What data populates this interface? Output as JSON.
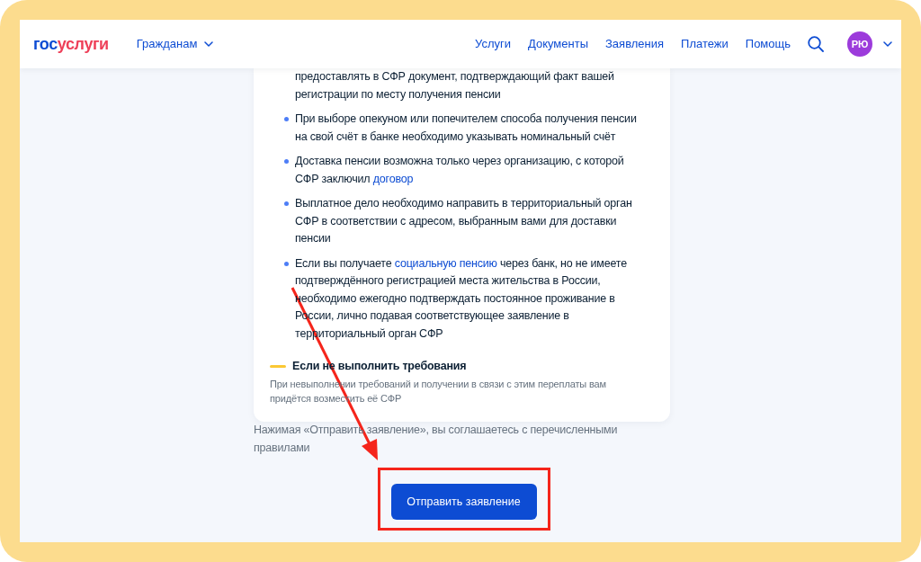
{
  "header": {
    "logo": [
      {
        "text": "гос",
        "color": "#0d4cd3"
      },
      {
        "text": "услуги",
        "color": "#ee3f58"
      }
    ],
    "audience_menu": "Гражданам",
    "nav": [
      "Услуги",
      "Документы",
      "Заявления",
      "Платежи",
      "Помощь"
    ],
    "user_initials": "РЮ"
  },
  "requirements": [
    {
      "kind": "continued",
      "parts": [
        {
          "kind": "text",
          "text": "предоставлять в СФР документ, подтверждающий факт вашей регистрации по месту получения пенсии"
        }
      ]
    },
    {
      "kind": "bullet",
      "parts": [
        {
          "kind": "text",
          "text": "При выборе опекуном или попечителем способа получения пенсии на свой счёт в банке необходимо указывать номинальный счёт"
        }
      ]
    },
    {
      "kind": "bullet",
      "parts": [
        {
          "kind": "text",
          "text": "Доставка пенсии возможна только через организацию, с которой СФР заключил "
        },
        {
          "kind": "link",
          "text": "договор"
        }
      ]
    },
    {
      "kind": "bullet",
      "parts": [
        {
          "kind": "text",
          "text": "Выплатное дело необходимо направить в территориальный орган СФР в соответствии с адресом, выбранным вами для доставки пенсии"
        }
      ]
    },
    {
      "kind": "bullet",
      "parts": [
        {
          "kind": "text",
          "text": "Если вы получаете "
        },
        {
          "kind": "link",
          "text": "социальную пенсию"
        },
        {
          "kind": "text",
          "text": " через банк, но не имеете подтверждённого регистрацией места жительства в России, необходимо ежегодно подтверждать постоянное проживание в России, лично подавая соответствующее заявление в территориальный орган СФР"
        }
      ]
    }
  ],
  "warning": {
    "title": "Если не выполнить требования",
    "text": "При невыполнении требований и получении в связи с этим переплаты вам придётся возместить её СФР"
  },
  "consent_note": "Нажимая «Отправить заявление», вы соглашаетесь с перечисленными правилами",
  "submit_button": "Отправить заявление"
}
